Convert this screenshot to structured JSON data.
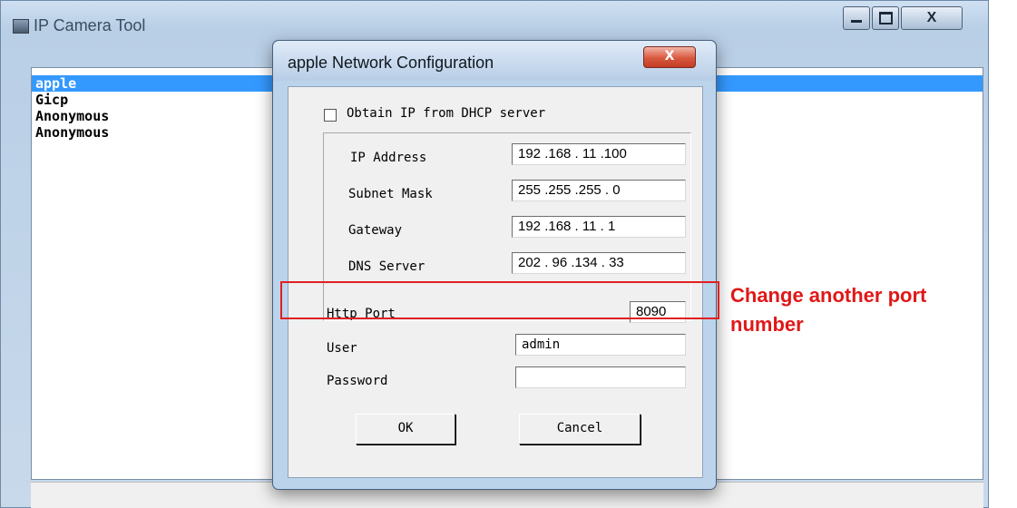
{
  "window": {
    "title": "IP Camera Tool",
    "buttons": {
      "close": "X"
    }
  },
  "devices": [
    {
      "name": "apple",
      "selected": true
    },
    {
      "name": "Gicp",
      "selected": false
    },
    {
      "name": "Anonymous",
      "selected": false
    },
    {
      "name": "Anonymous",
      "selected": false
    }
  ],
  "dialog": {
    "title": "apple Network Configuration",
    "close_label": "X",
    "dhcp_label": "Obtain IP from DHCP server",
    "dhcp_checked": false,
    "ip_address_label": "IP Address",
    "ip_address": "192 .168 . 11  .100",
    "subnet_label": "Subnet Mask",
    "subnet": "255 .255 .255 .  0",
    "gateway_label": "Gateway",
    "gateway": "192 .168 . 11  .  1",
    "dns_label": "DNS Server",
    "dns": "202 . 96  .134 . 33",
    "http_port_label": "Http Port",
    "http_port": "8090",
    "user_label": "User",
    "user": "admin",
    "password_label": "Password",
    "password": "",
    "ok_label": "OK",
    "cancel_label": "Cancel"
  },
  "annotation": {
    "line1": "Change another port",
    "line2": "number",
    "color": "#e01818"
  },
  "colors": {
    "selection": "#3399ff",
    "highlight_border": "#e02020"
  }
}
